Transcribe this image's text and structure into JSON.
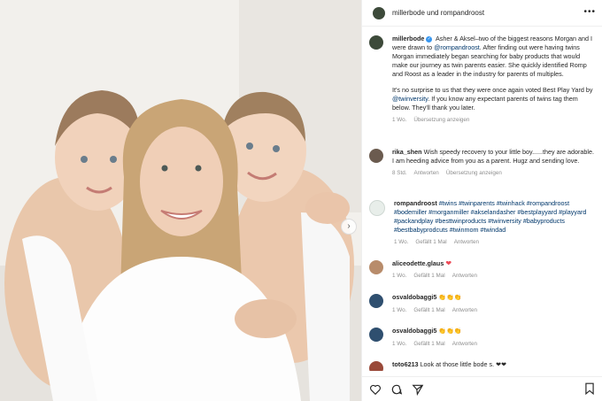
{
  "header": {
    "title": "millerbode und rompandroost",
    "more_icon": "more-icon"
  },
  "caption": {
    "user": "millerbode",
    "p1": "Asher & Aksel–two of the biggest reasons Morgan and I were drawn to ",
    "p1_tag": "@rompandroost",
    "p1_rest": ". After finding out were having twins Morgan immediately began searching for baby products that would make our journey as twin parents easier. She quickly identified Romp and Roost as a leader in the industry for parents of multiples.",
    "p2": "It's no surprise to us that they were once again voted Best Play Yard by ",
    "p2_tag": "@twinversity",
    "p2_rest": ". If you know any expectant parents of twins tag them below. They'll thank you later.",
    "time": "1 Wo.",
    "translate": "Übersetzung anzeigen"
  },
  "comments": [
    {
      "user": "rika_shen",
      "text": "Wish speedy recovery to your little boy......they are adorable. I am heeding advice from you as a parent. Hugz and sending love.",
      "time": "8 Std.",
      "reply": "Antworten",
      "translate": "Übersetzung anzeigen"
    },
    {
      "user": "rompandroost",
      "text": "#twins #twinparents #twinhack #rompandroost #bodemiller #morganmiller #akselandasher #bestplayyard #playyard #packandplay #besttwinproducts #twinversity #babyproducts #bestbabyprodcuts #twinmom #twindad",
      "time": "1 Wo.",
      "likes": "Gefällt 1 Mal",
      "reply": "Antworten"
    },
    {
      "user": "aliceodette.glaus",
      "text": "❤",
      "time": "1 Wo.",
      "likes": "Gefällt 1 Mal",
      "reply": "Antworten"
    },
    {
      "user": "osvaldobaggi5",
      "text": "👏👏👏",
      "time": "1 Wo.",
      "likes": "Gefällt 1 Mal",
      "reply": "Antworten"
    },
    {
      "user": "osvaldobaggi5",
      "text": "👏👏👏",
      "time": "1 Wo.",
      "likes": "Gefällt 1 Mal",
      "reply": "Antworten"
    },
    {
      "user": "toto6213",
      "text": "Look at those little bode s. ❤❤"
    }
  ],
  "actions": {
    "like": "heart-icon",
    "comment": "comment-icon",
    "share": "share-icon",
    "save": "bookmark-icon"
  },
  "colors": {
    "link": "#00376b",
    "heart": "#ed4956",
    "muted": "#8e8e8e"
  }
}
